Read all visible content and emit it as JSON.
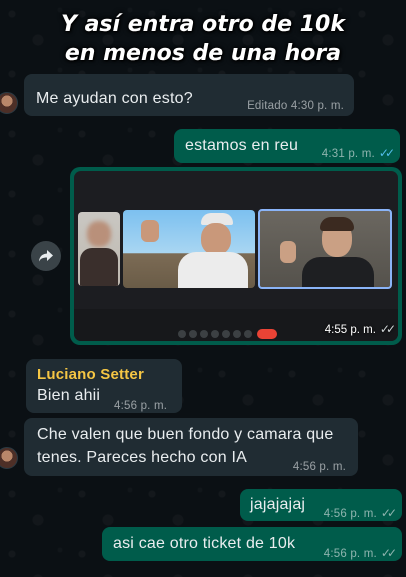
{
  "banner": {
    "line1": "Y así entra otro de 10k",
    "line2": "en menos de una hora"
  },
  "messages": [
    {
      "text": "Me ayudan con esto?",
      "time": "Editado 4:30 p. m."
    },
    {
      "text": "estamos en reu",
      "time": "4:31 p. m."
    },
    {
      "kind": "video",
      "time": "4:55 p. m."
    },
    {
      "sender": "Luciano Setter",
      "text": "Bien ahii",
      "time": "4:56 p. m."
    },
    {
      "text_line1": "Che valen que buen fondo y camara que",
      "text_line2": "tenes. Pareces hecho con IA",
      "time": "4:56 p. m."
    },
    {
      "text": "jajajajaj",
      "time": "4:56 p. m."
    },
    {
      "text": "asi cae otro ticket de 10k",
      "time": "4:56 p. m."
    }
  ],
  "icons": {
    "forward": "forward-arrow-icon",
    "read_receipt": "double-check-icon"
  },
  "colors": {
    "incoming_bubble": "#202c33",
    "outgoing_bubble": "#005c4b",
    "read_tick": "#53bdeb",
    "sender_name": "#f5c644",
    "meet_end_call": "#ea4335"
  }
}
